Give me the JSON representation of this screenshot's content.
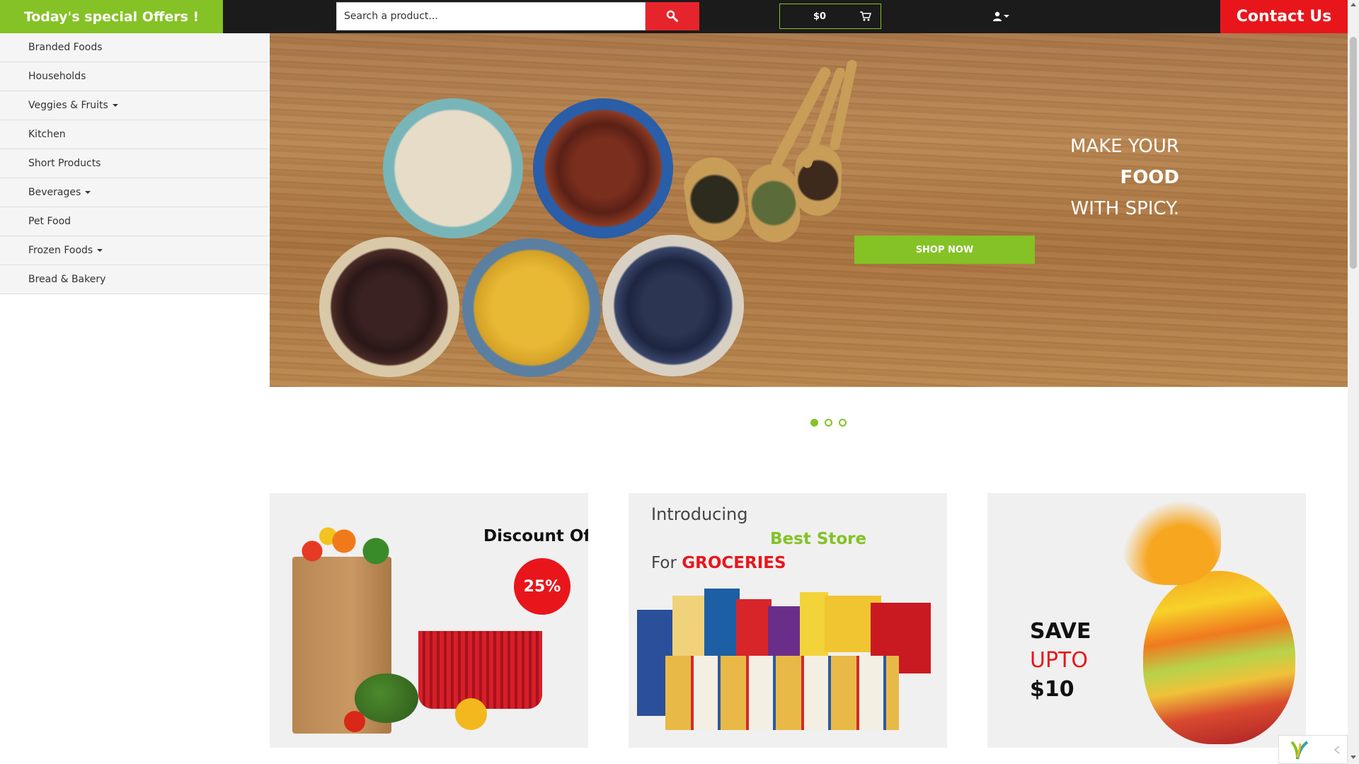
{
  "header": {
    "offers_label": "Today's special Offers !",
    "search_placeholder": "Search a product...",
    "cart_total": "$0",
    "contact_label": "Contact Us"
  },
  "sidebar": {
    "items": [
      {
        "label": "Branded Foods",
        "has_dropdown": false
      },
      {
        "label": "Households",
        "has_dropdown": false
      },
      {
        "label": "Veggies & Fruits",
        "has_dropdown": true
      },
      {
        "label": "Kitchen",
        "has_dropdown": false
      },
      {
        "label": "Short Products",
        "has_dropdown": false
      },
      {
        "label": "Beverages",
        "has_dropdown": true
      },
      {
        "label": "Pet Food",
        "has_dropdown": false
      },
      {
        "label": "Frozen Foods",
        "has_dropdown": true
      },
      {
        "label": "Bread & Bakery",
        "has_dropdown": false
      }
    ]
  },
  "hero": {
    "line1": "MAKE YOUR",
    "line2": "FOOD",
    "line3": "WITH SPICY.",
    "cta_label": "SHOP NOW",
    "slides": 3,
    "active_slide": 1
  },
  "promos": {
    "discount": {
      "title": "Discount Offer",
      "badge": "25%"
    },
    "store": {
      "intro": "Introducing",
      "highlight": "Best Store",
      "for_prefix": "For",
      "for_highlight": "GROCERIES"
    },
    "save": {
      "line1": "SAVE",
      "line2": "UPTO",
      "line3": "$10"
    }
  },
  "colors": {
    "brand_green": "#84c225",
    "brand_red": "#e8161b",
    "topbar_bg": "#1b1b1b"
  },
  "icons": [
    "search-icon",
    "cart-icon",
    "user-icon",
    "caret-down-icon",
    "chat-logo-icon",
    "chevron-left-icon"
  ]
}
